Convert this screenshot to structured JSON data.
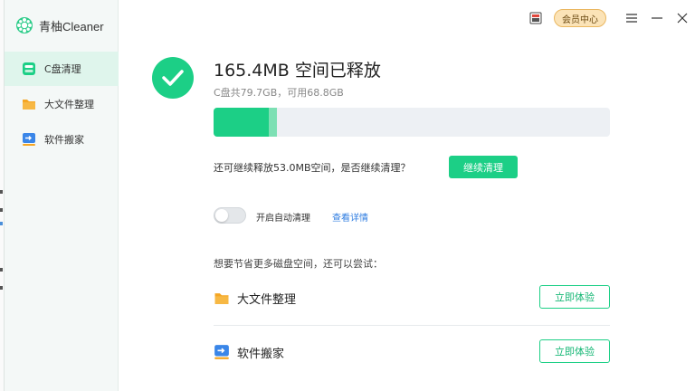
{
  "app": {
    "logo_name": "青柚Cleaner",
    "brand_color": "#1ccf86"
  },
  "titlebar": {
    "vip_label": "会员中心",
    "icons": [
      "flag-icon",
      "menu-icon",
      "minimize-icon",
      "close-icon"
    ]
  },
  "sidebar": {
    "items": [
      {
        "label": "C盘清理",
        "icon": "drive-icon",
        "active": true
      },
      {
        "label": "大文件整理",
        "icon": "folder-icon",
        "active": false
      },
      {
        "label": "软件搬家",
        "icon": "move-icon",
        "active": false
      }
    ]
  },
  "result": {
    "headline": "165.4MB 空间已释放",
    "disk_info": "C盘共79.7GB，可用68.8GB",
    "used_fraction": 0.14,
    "freed_fraction": 0.02,
    "continue_text": "还可继续释放53.0MB空间，是否继续清理？",
    "continue_button": "继续清理"
  },
  "auto_clean": {
    "label": "开启自动清理",
    "enabled": false,
    "details_link": "查看详情"
  },
  "suggestions": {
    "intro": "想要节省更多磁盘空间，还可以尝试：",
    "items": [
      {
        "title": "大文件整理",
        "icon": "folder-icon",
        "button": "立即体验"
      },
      {
        "title": "软件搬家",
        "icon": "move-icon",
        "button": "立即体验"
      }
    ]
  }
}
